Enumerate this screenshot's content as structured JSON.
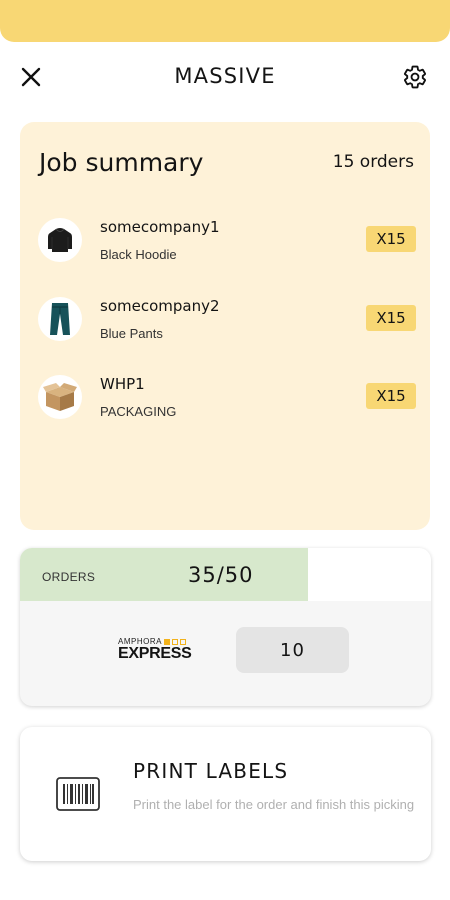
{
  "header": {
    "title": "MASSIVE"
  },
  "colors": {
    "accent": "#f8d774",
    "summary_bg": "#fef2d8",
    "progress_fill": "#d7e8cc"
  },
  "summary": {
    "title": "Job summary",
    "count_label": "15 orders",
    "items": [
      {
        "name": "somecompany1",
        "sub": "Black Hoodie",
        "qty": "X15",
        "icon": "hoodie-icon"
      },
      {
        "name": "somecompany2",
        "sub": "Blue Pants",
        "qty": "X15",
        "icon": "pants-icon"
      },
      {
        "name": "WHP1",
        "sub": "PACKAGING",
        "qty": "X15",
        "icon": "box-icon"
      }
    ]
  },
  "orders": {
    "label": "ORDERS",
    "value": "35/50",
    "progress": 0.7,
    "carrier": {
      "top": "AMPHORA",
      "name": "EXPRESS"
    },
    "count": "10"
  },
  "print": {
    "title": "PRINT LABELS",
    "description": "Print the label for the order and finish this picking",
    "icon": "barcode-icon"
  }
}
